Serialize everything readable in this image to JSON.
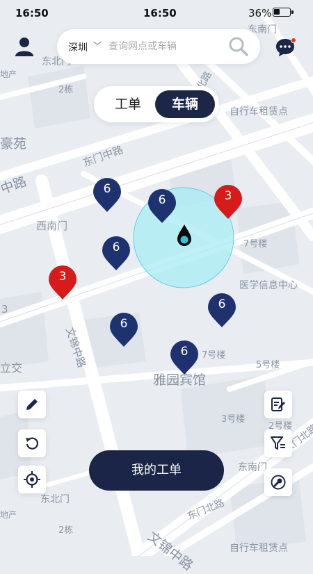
{
  "status_bar": {
    "time_left": "16:50",
    "time_center": "16:50",
    "battery": "36%",
    "battery_level": 0.36
  },
  "search": {
    "city": "深圳",
    "placeholder": "查询网点或车辆"
  },
  "tabs": [
    {
      "label": "工单",
      "active": false
    },
    {
      "label": "车辆",
      "active": true
    }
  ],
  "bottom": {
    "orders_button": "我的工单"
  },
  "markers": [
    {
      "count": "6",
      "type": "blue"
    },
    {
      "count": "6",
      "type": "blue"
    },
    {
      "count": "3",
      "type": "red"
    },
    {
      "count": "6",
      "type": "blue"
    },
    {
      "count": "3",
      "type": "red"
    },
    {
      "count": "6",
      "type": "blue"
    },
    {
      "count": "6",
      "type": "blue"
    },
    {
      "count": "6",
      "type": "blue"
    }
  ],
  "map_labels": [
    "东北门",
    "2栋",
    "东门北路",
    "自行车租赁点",
    "豪苑",
    "东门中路",
    "中路",
    "西南门",
    "7号楼",
    "医学信息中心",
    "文锦中路",
    "3",
    "7号楼",
    "5号楼",
    "雅园宾馆",
    "立交",
    "3号楼",
    "2号楼",
    "东南门",
    "东门北路",
    "东北门",
    "2栋",
    "文锦中路",
    "自行车租赁点",
    "东门北路",
    "地产",
    "地产",
    "东南门"
  ],
  "colors": {
    "navy": "#1c2748",
    "red_marker": "#d71a1a",
    "blue_marker": "#1e3270",
    "circle": "#9ee6f0"
  }
}
